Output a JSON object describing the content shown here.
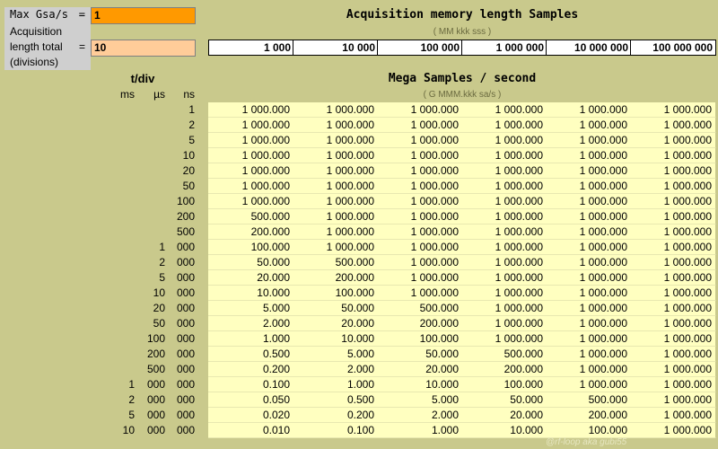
{
  "params": {
    "max_gsa_label": "Max Gsa/s",
    "eq": "=",
    "max_gsa_value": "1",
    "acq_label_1": "Acquisition",
    "acq_label_2": "length total",
    "acq_label_3": "(divisions)",
    "acq_value": "10"
  },
  "header": {
    "title": "Acquisition memory length  Samples",
    "hint": "(  MM kkk sss  )"
  },
  "memory_lengths": [
    "1 000",
    "10 000",
    "100 000",
    "1 000 000",
    "10 000 000",
    "100 000 000"
  ],
  "tdiv": {
    "title": "t/div",
    "units": [
      "ms",
      "µs",
      "ns"
    ]
  },
  "rate": {
    "title": "Mega Samples / second",
    "hint": "(   G MMM.kkk       sa/s   )"
  },
  "rows": [
    {
      "ms": "",
      "us": "",
      "ns": "1",
      "v": [
        "1 000.000",
        "1 000.000",
        "1 000.000",
        "1 000.000",
        "1 000.000",
        "1 000.000"
      ]
    },
    {
      "ms": "",
      "us": "",
      "ns": "2",
      "v": [
        "1 000.000",
        "1 000.000",
        "1 000.000",
        "1 000.000",
        "1 000.000",
        "1 000.000"
      ]
    },
    {
      "ms": "",
      "us": "",
      "ns": "5",
      "v": [
        "1 000.000",
        "1 000.000",
        "1 000.000",
        "1 000.000",
        "1 000.000",
        "1 000.000"
      ]
    },
    {
      "ms": "",
      "us": "",
      "ns": "10",
      "v": [
        "1 000.000",
        "1 000.000",
        "1 000.000",
        "1 000.000",
        "1 000.000",
        "1 000.000"
      ]
    },
    {
      "ms": "",
      "us": "",
      "ns": "20",
      "v": [
        "1 000.000",
        "1 000.000",
        "1 000.000",
        "1 000.000",
        "1 000.000",
        "1 000.000"
      ]
    },
    {
      "ms": "",
      "us": "",
      "ns": "50",
      "v": [
        "1 000.000",
        "1 000.000",
        "1 000.000",
        "1 000.000",
        "1 000.000",
        "1 000.000"
      ]
    },
    {
      "ms": "",
      "us": "",
      "ns": "100",
      "v": [
        "1 000.000",
        "1 000.000",
        "1 000.000",
        "1 000.000",
        "1 000.000",
        "1 000.000"
      ]
    },
    {
      "ms": "",
      "us": "",
      "ns": "200",
      "v": [
        "500.000",
        "1 000.000",
        "1 000.000",
        "1 000.000",
        "1 000.000",
        "1 000.000"
      ]
    },
    {
      "ms": "",
      "us": "",
      "ns": "500",
      "v": [
        "200.000",
        "1 000.000",
        "1 000.000",
        "1 000.000",
        "1 000.000",
        "1 000.000"
      ]
    },
    {
      "ms": "",
      "us": "1",
      "ns": "000",
      "v": [
        "100.000",
        "1 000.000",
        "1 000.000",
        "1 000.000",
        "1 000.000",
        "1 000.000"
      ]
    },
    {
      "ms": "",
      "us": "2",
      "ns": "000",
      "v": [
        "50.000",
        "500.000",
        "1 000.000",
        "1 000.000",
        "1 000.000",
        "1 000.000"
      ]
    },
    {
      "ms": "",
      "us": "5",
      "ns": "000",
      "v": [
        "20.000",
        "200.000",
        "1 000.000",
        "1 000.000",
        "1 000.000",
        "1 000.000"
      ]
    },
    {
      "ms": "",
      "us": "10",
      "ns": "000",
      "v": [
        "10.000",
        "100.000",
        "1 000.000",
        "1 000.000",
        "1 000.000",
        "1 000.000"
      ]
    },
    {
      "ms": "",
      "us": "20",
      "ns": "000",
      "v": [
        "5.000",
        "50.000",
        "500.000",
        "1 000.000",
        "1 000.000",
        "1 000.000"
      ]
    },
    {
      "ms": "",
      "us": "50",
      "ns": "000",
      "v": [
        "2.000",
        "20.000",
        "200.000",
        "1 000.000",
        "1 000.000",
        "1 000.000"
      ]
    },
    {
      "ms": "",
      "us": "100",
      "ns": "000",
      "v": [
        "1.000",
        "10.000",
        "100.000",
        "1 000.000",
        "1 000.000",
        "1 000.000"
      ]
    },
    {
      "ms": "",
      "us": "200",
      "ns": "000",
      "v": [
        "0.500",
        "5.000",
        "50.000",
        "500.000",
        "1 000.000",
        "1 000.000"
      ]
    },
    {
      "ms": "",
      "us": "500",
      "ns": "000",
      "v": [
        "0.200",
        "2.000",
        "20.000",
        "200.000",
        "1 000.000",
        "1 000.000"
      ]
    },
    {
      "ms": "1",
      "us": "000",
      "ns": "000",
      "v": [
        "0.100",
        "1.000",
        "10.000",
        "100.000",
        "1 000.000",
        "1 000.000"
      ]
    },
    {
      "ms": "2",
      "us": "000",
      "ns": "000",
      "v": [
        "0.050",
        "0.500",
        "5.000",
        "50.000",
        "500.000",
        "1 000.000"
      ]
    },
    {
      "ms": "5",
      "us": "000",
      "ns": "000",
      "v": [
        "0.020",
        "0.200",
        "2.000",
        "20.000",
        "200.000",
        "1 000.000"
      ]
    },
    {
      "ms": "10",
      "us": "000",
      "ns": "000",
      "v": [
        "0.010",
        "0.100",
        "1.000",
        "10.000",
        "100.000",
        "1 000.000"
      ]
    }
  ],
  "watermark": "@rf-loop aka gubi55",
  "colors": {
    "background": "#c9c98c",
    "input_main": "#ff9900",
    "input_secondary": "#ffcc99",
    "cell": "#ffffc0"
  }
}
